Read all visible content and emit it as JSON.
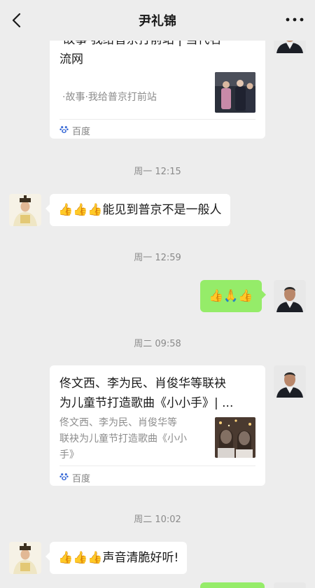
{
  "header": {
    "title": "尹礼锦"
  },
  "messages": {
    "card1": {
      "title_partial": "·故事·我给普京打前站 | 当代名",
      "title_line2": "流网",
      "desc": "·故事·我给普京打前站",
      "source": "百度"
    },
    "time1": "周一 12:15",
    "msg1": "👍👍👍能见到普京不是一般人",
    "time2": "周一 12:59",
    "msg2": "👍🙏👍",
    "time3": "周二 09:58",
    "card2": {
      "title_line1": "佟文西、李为民、肖俊华等联袂",
      "title_line2": "为儿童节打造歌曲《小小手》| ...",
      "desc_line1": "佟文西、李为民、肖俊华等",
      "desc_line2": "联袂为儿童节打造歌曲《小小",
      "desc_line3": "手》",
      "source": "百度"
    },
    "time4": "周二 10:02",
    "msg3": "👍👍👍声音清脆好听!"
  },
  "icons": {
    "back": "chevron-left-icon",
    "more": "more-dots-icon",
    "source": "baidu-paw-icon"
  },
  "colors": {
    "background": "#ededed",
    "outgoing_bubble": "#95ec69",
    "incoming_bubble": "#ffffff",
    "timestamp": "#8a8a8a"
  }
}
